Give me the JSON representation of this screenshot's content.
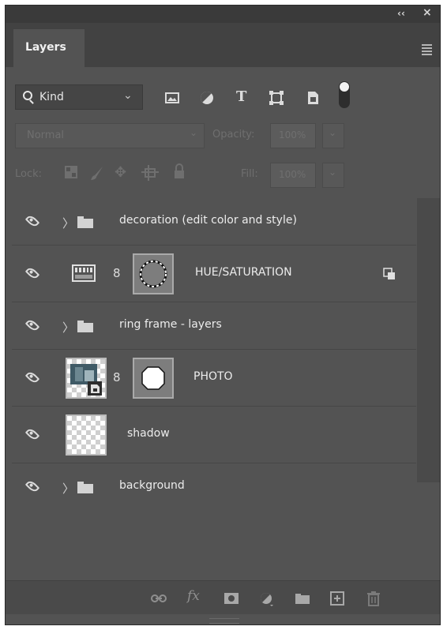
{
  "panel": {
    "tab_label": "Layers",
    "collapse_glyph": "‹‹",
    "close_glyph": "×"
  },
  "filter": {
    "kind_label": "Kind",
    "icons": [
      "pixel-filter-icon",
      "adjustment-filter-icon",
      "type-filter-icon",
      "shape-filter-icon",
      "smart-object-filter-icon",
      "filter-toggle-icon"
    ],
    "type_glyph": "T"
  },
  "blend": {
    "mode": "Normal",
    "opacity_label": "Opacity:",
    "opacity_value": "100%"
  },
  "lock": {
    "label": "Lock:",
    "fill_label": "Fill:",
    "fill_value": "100%"
  },
  "layers": [
    {
      "name": "decoration (edit color and style)",
      "kind": "group"
    },
    {
      "name": "HUE/SATURATION",
      "kind": "adjustment"
    },
    {
      "name": "ring frame - layers",
      "kind": "group"
    },
    {
      "name": "PHOTO",
      "kind": "smart-object"
    },
    {
      "name": "shadow",
      "kind": "pixel"
    },
    {
      "name": "background",
      "kind": "group"
    }
  ],
  "bottom_bar": {
    "fx_label": "fx",
    "icons": [
      "link-layers-icon",
      "fx-icon",
      "add-mask-icon",
      "new-adjustment-icon",
      "new-group-icon",
      "new-layer-icon",
      "delete-layer-icon"
    ]
  },
  "colors": {
    "panel_bg": "#535353",
    "header_bg": "#424242",
    "text": "#ececec",
    "dim_text": "#6f6f6f"
  }
}
